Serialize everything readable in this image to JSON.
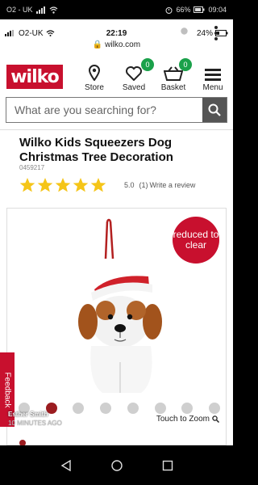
{
  "os_status": {
    "carrier": "O2 - UK",
    "battery": "66%",
    "time": "09:04"
  },
  "ios_status": {
    "carrier": "O2-UK",
    "time": "22:19",
    "battery": "24%",
    "url": "wilko.com"
  },
  "header": {
    "logo": "wilko",
    "nav": [
      {
        "label": "Store",
        "icon": "location-pin-icon"
      },
      {
        "label": "Saved",
        "icon": "heart-icon",
        "badge": "0"
      },
      {
        "label": "Basket",
        "icon": "basket-icon",
        "badge": "0"
      },
      {
        "label": "Menu",
        "icon": "hamburger-icon"
      }
    ]
  },
  "search": {
    "placeholder": "What are you searching for?"
  },
  "product": {
    "title": "Wilko Kids Squeezers Dog Christmas Tree Decoration",
    "sku": "0459217",
    "rating_value": "5.0",
    "rating_count": "(1)",
    "stars": 5,
    "review_link": "Write a review"
  },
  "image_panel": {
    "badge": "reduced to clear",
    "zoom_label": "Touch to Zoom",
    "dots_count": 8,
    "active_dot": 1
  },
  "feedback_label": "Feedback",
  "toast": {
    "name": "Esther Smith",
    "time": "10 MINUTES AGO"
  },
  "colors": {
    "brand_red": "#c8102e",
    "badge_green": "#1aa14a",
    "star_gold": "#f5c518",
    "dot_active": "#9b1c20"
  }
}
